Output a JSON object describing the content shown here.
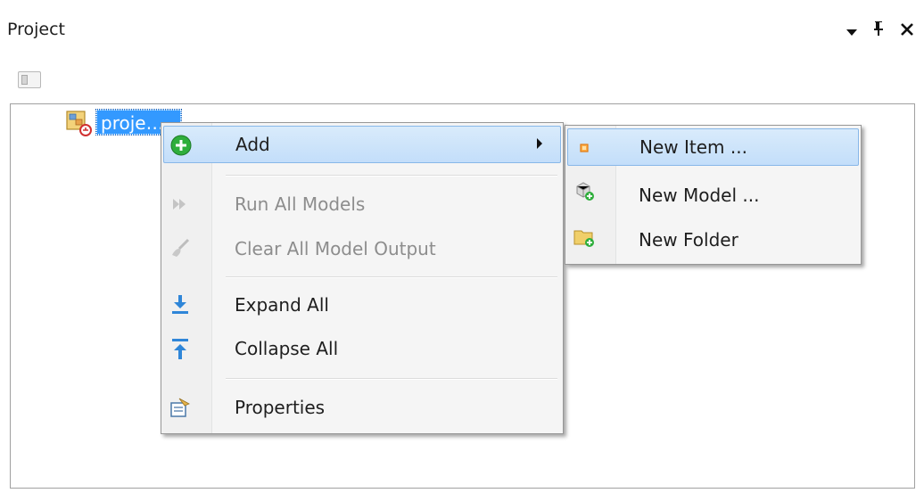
{
  "panel": {
    "title": "Project",
    "controls": [
      "dropdown-arrow-icon",
      "pin-icon",
      "close-icon"
    ]
  },
  "tree": {
    "root_label": "proje…"
  },
  "context_menu": {
    "items": [
      {
        "label": "Add",
        "icon": "add-circle-icon",
        "enabled": true,
        "highlighted": true,
        "has_submenu": true
      },
      {
        "label": "Run All Models",
        "icon": "run-all-icon",
        "enabled": false
      },
      {
        "label": "Clear All Model Output",
        "icon": "brush-icon",
        "enabled": false
      },
      {
        "label": "Expand All",
        "icon": "expand-all-icon",
        "enabled": true
      },
      {
        "label": "Collapse All",
        "icon": "collapse-all-icon",
        "enabled": true
      },
      {
        "label": "Properties",
        "icon": "properties-icon",
        "enabled": true
      }
    ]
  },
  "submenu": {
    "items": [
      {
        "label": "New Item ...",
        "icon": "new-item-icon",
        "highlighted": true
      },
      {
        "label": "New Model ...",
        "icon": "new-model-icon"
      },
      {
        "label": "New Folder",
        "icon": "new-folder-icon"
      }
    ]
  },
  "colors": {
    "selection": "#3399ff",
    "menu_highlight": "#c3defa",
    "menu_border": "#979797",
    "disabled_text": "#8d8d8d"
  }
}
